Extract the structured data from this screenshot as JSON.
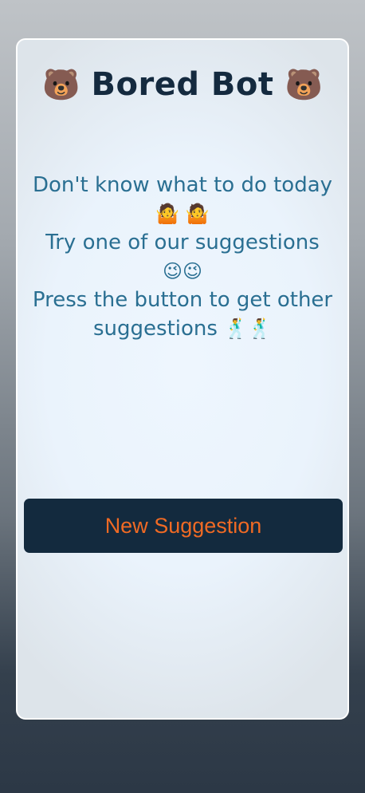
{
  "app": {
    "title": "Bored Bot",
    "bear_emoji": "🐻"
  },
  "message": {
    "line1": "Don't know what to do today",
    "line1_emoji": "🤷 🤷",
    "line2": "Try one of our suggestions",
    "line2_emoji": "😉😉",
    "line3": "Press the button to get other suggestions",
    "line3_emoji": "🕺🕺"
  },
  "button": {
    "label": "New Suggestion"
  },
  "colors": {
    "title": "#142a3f",
    "message_text": "#2a6f92",
    "button_bg": "#132a3e",
    "button_text": "#f06a24"
  }
}
